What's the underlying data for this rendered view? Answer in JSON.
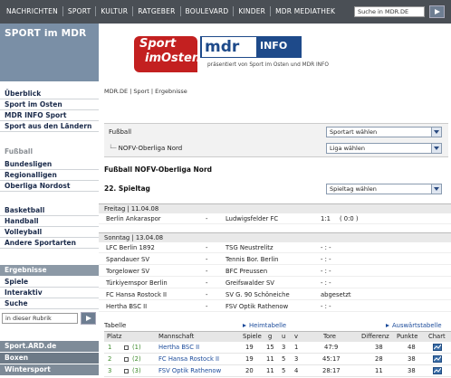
{
  "topnav": {
    "items": [
      "NACHRICHTEN",
      "SPORT",
      "KULTUR",
      "RATGEBER",
      "BOULEVARD",
      "KINDER",
      "MDR MEDIATHEK"
    ],
    "search_value": "Suche in MDR.DE"
  },
  "header": {
    "section_title": "SPORT im MDR",
    "logo_sport_line1": "Sport",
    "logo_sport_line2": "imOsten",
    "logo_mdr": "mdr",
    "logo_info": "INFO",
    "presented_by": "präsentiert von Sport im Osten und MDR INFO"
  },
  "sidebar": {
    "links_top": [
      "Überblick",
      "Sport im Osten",
      "MDR INFO Sport",
      "Sport aus den Ländern"
    ],
    "section_fussball": "Fußball",
    "links_fussball": [
      "Bundesligen",
      "Regionalligen",
      "Oberliga Nordost"
    ],
    "links_other": [
      "Basketball",
      "Handball",
      "Volleyball",
      "Andere Sportarten"
    ],
    "group_head": "Ergebnisse",
    "links_group": [
      "Spiele",
      "Interaktiv",
      "Suche"
    ],
    "rubrik_search_value": "in dieser Rubrik",
    "bottom_links": [
      "Sport.ARD.de",
      "Boxen",
      "Wintersport"
    ]
  },
  "main": {
    "breadcrumb": "MDR.DE | Sport | Ergebnisse",
    "filter_sport_label": "Fußball",
    "filter_liga_label": "NOFV-Oberliga Nord",
    "select_sport": "Sportart wählen",
    "select_liga": "Liga wählen",
    "liga_title": "Fußball NOFV-Oberliga Nord",
    "spieltag_title": "22. Spieltag",
    "select_spieltag": "Spieltag wählen"
  },
  "matchdays": [
    {
      "head": "Freitag | 11.04.08",
      "matches": [
        {
          "home": "Berlin Ankaraspor",
          "dash": "-",
          "away": "Ludwigsfelder FC",
          "result": "1:1",
          "half": "( 0:0 )"
        }
      ]
    },
    {
      "head": "Sonntag | 13.04.08",
      "matches": [
        {
          "home": "LFC Berlin 1892",
          "dash": "-",
          "away": "TSG Neustrelitz",
          "result": "- : -",
          "half": ""
        },
        {
          "home": "Spandauer SV",
          "dash": "-",
          "away": "Tennis Bor. Berlin",
          "result": "- : -",
          "half": ""
        },
        {
          "home": "Torgelower SV",
          "dash": "-",
          "away": "BFC Preussen",
          "result": "- : -",
          "half": ""
        },
        {
          "home": "Türkiyemspor Berlin",
          "dash": "-",
          "away": "Greifswalder SV",
          "result": "- : -",
          "half": ""
        },
        {
          "home": "FC Hansa Rostock II",
          "dash": "-",
          "away": "SV G. 90 Schöneiche",
          "result": "abgesetzt",
          "half": ""
        },
        {
          "home": "Hertha BSC II",
          "dash": "-",
          "away": "FSV Optik Rathenow",
          "result": "- : -",
          "half": ""
        }
      ]
    }
  ],
  "table": {
    "title": "Tabelle",
    "heim_link": "Heimtabelle",
    "auswaerts_link": "Auswärtstabelle",
    "columns": [
      "Platz",
      "Mannschaft",
      "Spiele",
      "g",
      "u",
      "v",
      "Tore",
      "Differenz",
      "Punkte",
      "Chart"
    ],
    "rows": [
      {
        "platz": "1",
        "prev": "(1)",
        "team": "Hertha BSC II",
        "spiele": "19",
        "g": "15",
        "u": "3",
        "v": "1",
        "tore": "47:9",
        "diff": "38",
        "punkte": "48"
      },
      {
        "platz": "2",
        "prev": "(2)",
        "team": "FC Hansa Rostock II",
        "spiele": "19",
        "g": "11",
        "u": "5",
        "v": "3",
        "tore": "45:17",
        "diff": "28",
        "punkte": "38"
      },
      {
        "platz": "3",
        "prev": "(3)",
        "team": "FSV Optik Rathenow",
        "spiele": "20",
        "g": "11",
        "u": "5",
        "v": "4",
        "tore": "28:17",
        "diff": "11",
        "punkte": "38"
      }
    ]
  }
}
